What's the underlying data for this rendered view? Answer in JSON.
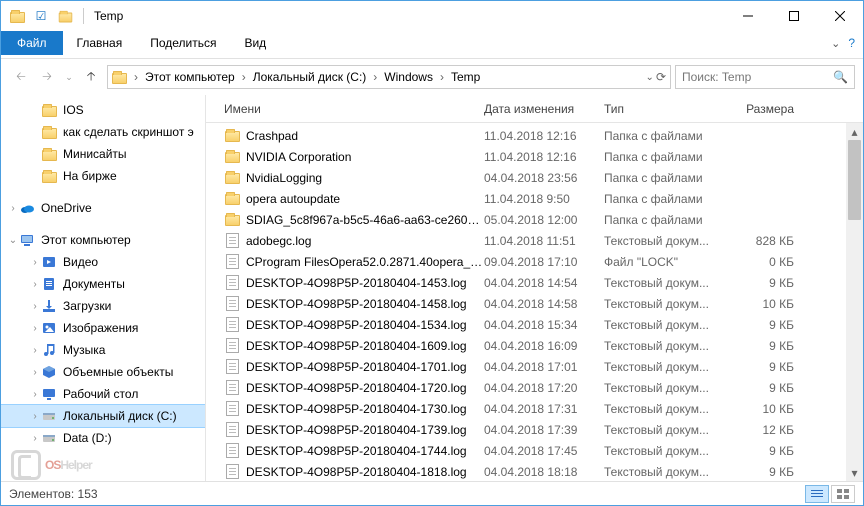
{
  "title": "Temp",
  "ribbon": {
    "file": "Файл",
    "tabs": [
      "Главная",
      "Поделиться",
      "Вид"
    ]
  },
  "breadcrumb": [
    "Этот компьютер",
    "Локальный диск (C:)",
    "Windows",
    "Temp"
  ],
  "search_placeholder": "Поиск: Temp",
  "columns": {
    "name": "Имени",
    "date": "Дата изменения",
    "type": "Тип",
    "size": "Размера"
  },
  "tree": {
    "quick": [
      {
        "label": "IOS",
        "icon": "folder"
      },
      {
        "label": "как сделать скриншот э",
        "icon": "folder"
      },
      {
        "label": "Минисайты",
        "icon": "folder"
      },
      {
        "label": "На бирже",
        "icon": "folder"
      }
    ],
    "onedrive": "OneDrive",
    "thispc": "Этот компьютер",
    "thispc_children": [
      {
        "label": "Видео",
        "icon": "video",
        "color": "#3a78d6"
      },
      {
        "label": "Документы",
        "icon": "docs",
        "color": "#3a78d6"
      },
      {
        "label": "Загрузки",
        "icon": "downloads",
        "color": "#3a78d6"
      },
      {
        "label": "Изображения",
        "icon": "pictures",
        "color": "#3a78d6"
      },
      {
        "label": "Музыка",
        "icon": "music",
        "color": "#3a78d6"
      },
      {
        "label": "Объемные объекты",
        "icon": "3d",
        "color": "#3a78d6"
      },
      {
        "label": "Рабочий стол",
        "icon": "desktop",
        "color": "#3a78d6"
      },
      {
        "label": "Локальный диск (C:)",
        "icon": "drive",
        "selected": true
      },
      {
        "label": "Data (D:)",
        "icon": "drive"
      }
    ]
  },
  "files": [
    {
      "name": "Crashpad",
      "date": "11.04.2018 12:16",
      "type": "Папка с файлами",
      "size": "",
      "icon": "folder"
    },
    {
      "name": "NVIDIA Corporation",
      "date": "11.04.2018 12:16",
      "type": "Папка с файлами",
      "size": "",
      "icon": "folder"
    },
    {
      "name": "NvidiaLogging",
      "date": "04.04.2018 23:56",
      "type": "Папка с файлами",
      "size": "",
      "icon": "folder"
    },
    {
      "name": "opera autoupdate",
      "date": "11.04.2018 9:50",
      "type": "Папка с файлами",
      "size": "",
      "icon": "folder"
    },
    {
      "name": "SDIAG_5c8f967a-b5c5-46a6-aa63-ce260af...",
      "date": "05.04.2018 12:00",
      "type": "Папка с файлами",
      "size": "",
      "icon": "folder"
    },
    {
      "name": "adobegc.log",
      "date": "11.04.2018 11:51",
      "type": "Текстовый докум...",
      "size": "828 КБ",
      "icon": "file"
    },
    {
      "name": "CProgram FilesOpera52.0.2871.40opera_a...",
      "date": "09.04.2018 17:10",
      "type": "Файл \"LOCK\"",
      "size": "0 КБ",
      "icon": "file"
    },
    {
      "name": "DESKTOP-4O98P5P-20180404-1453.log",
      "date": "04.04.2018 14:54",
      "type": "Текстовый докум...",
      "size": "9 КБ",
      "icon": "file"
    },
    {
      "name": "DESKTOP-4O98P5P-20180404-1458.log",
      "date": "04.04.2018 14:58",
      "type": "Текстовый докум...",
      "size": "10 КБ",
      "icon": "file"
    },
    {
      "name": "DESKTOP-4O98P5P-20180404-1534.log",
      "date": "04.04.2018 15:34",
      "type": "Текстовый докум...",
      "size": "9 КБ",
      "icon": "file"
    },
    {
      "name": "DESKTOP-4O98P5P-20180404-1609.log",
      "date": "04.04.2018 16:09",
      "type": "Текстовый докум...",
      "size": "9 КБ",
      "icon": "file"
    },
    {
      "name": "DESKTOP-4O98P5P-20180404-1701.log",
      "date": "04.04.2018 17:01",
      "type": "Текстовый докум...",
      "size": "9 КБ",
      "icon": "file"
    },
    {
      "name": "DESKTOP-4O98P5P-20180404-1720.log",
      "date": "04.04.2018 17:20",
      "type": "Текстовый докум...",
      "size": "9 КБ",
      "icon": "file"
    },
    {
      "name": "DESKTOP-4O98P5P-20180404-1730.log",
      "date": "04.04.2018 17:31",
      "type": "Текстовый докум...",
      "size": "10 КБ",
      "icon": "file"
    },
    {
      "name": "DESKTOP-4O98P5P-20180404-1739.log",
      "date": "04.04.2018 17:39",
      "type": "Текстовый докум...",
      "size": "12 КБ",
      "icon": "file"
    },
    {
      "name": "DESKTOP-4O98P5P-20180404-1744.log",
      "date": "04.04.2018 17:45",
      "type": "Текстовый докум...",
      "size": "9 КБ",
      "icon": "file"
    },
    {
      "name": "DESKTOP-4O98P5P-20180404-1818.log",
      "date": "04.04.2018 18:18",
      "type": "Текстовый докум...",
      "size": "9 КБ",
      "icon": "file"
    }
  ],
  "status": {
    "count_label": "Элементов:",
    "count": "153"
  },
  "watermark": {
    "part1": "OS",
    "part2": "Helper"
  }
}
